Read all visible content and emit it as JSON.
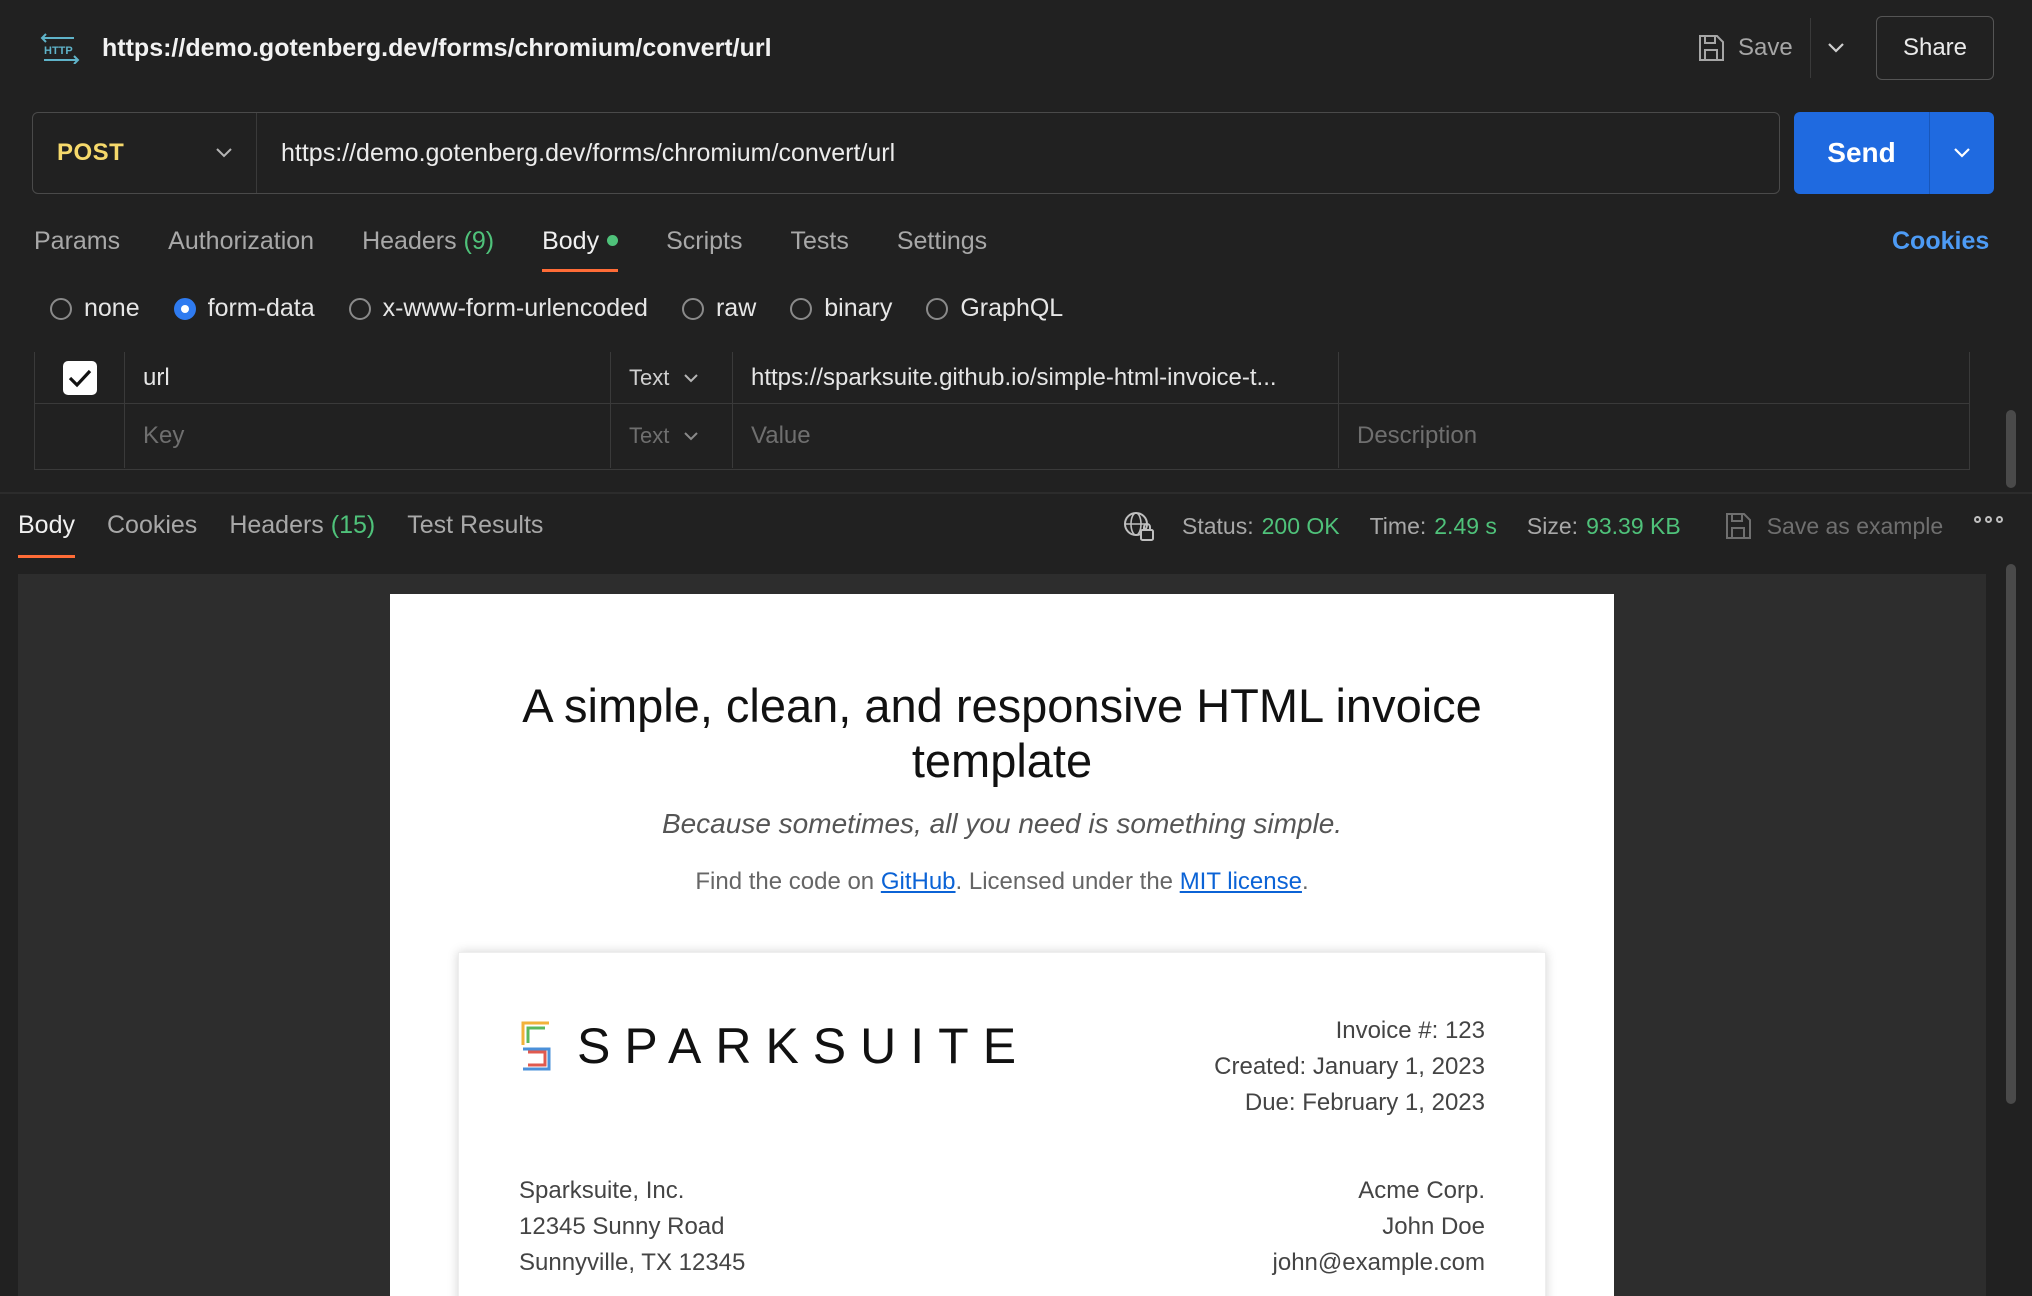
{
  "header": {
    "request_title": "https://demo.gotenberg.dev/forms/chromium/convert/url",
    "save_label": "Save",
    "share_label": "Share"
  },
  "url_bar": {
    "method": "POST",
    "url": "https://demo.gotenberg.dev/forms/chromium/convert/url",
    "send_label": "Send"
  },
  "request_tabs": {
    "params": "Params",
    "authorization": "Authorization",
    "headers": "Headers",
    "headers_count": "(9)",
    "body": "Body",
    "scripts": "Scripts",
    "tests": "Tests",
    "settings": "Settings",
    "cookies": "Cookies"
  },
  "body_types": {
    "none": "none",
    "form_data": "form-data",
    "urlencoded": "x-www-form-urlencoded",
    "raw": "raw",
    "binary": "binary",
    "graphql": "GraphQL",
    "selected": "form-data"
  },
  "form_rows": [
    {
      "checked": true,
      "key": "url",
      "type": "Text",
      "value": "https://sparksuite.github.io/simple-html-invoice-t...",
      "description": ""
    }
  ],
  "form_placeholders": {
    "key": "Key",
    "type": "Text",
    "value": "Value",
    "description": "Description"
  },
  "response_tabs": {
    "body": "Body",
    "cookies": "Cookies",
    "headers": "Headers",
    "headers_count": "(15)",
    "test_results": "Test Results"
  },
  "response_meta": {
    "status_label": "Status:",
    "status_value": "200 OK",
    "time_label": "Time:",
    "time_value": "2.49 s",
    "size_label": "Size:",
    "size_value": "93.39 KB",
    "save_example": "Save as example"
  },
  "preview": {
    "title": "A simple, clean, and responsive HTML invoice template",
    "subtitle": "Because sometimes, all you need is something simple.",
    "find_prefix": "Find the code on ",
    "github_link": "GitHub",
    "find_middle": ". Licensed under the ",
    "license_link": "MIT license",
    "find_suffix": ".",
    "logo_text": "SPARKSUITE",
    "invoice_number": "Invoice #: 123",
    "created": "Created: January 1, 2023",
    "due": "Due: February 1, 2023",
    "from": [
      "Sparksuite, Inc.",
      "12345 Sunny Road",
      "Sunnyville, TX 12345"
    ],
    "to": [
      "Acme Corp.",
      "John Doe",
      "john@example.com"
    ]
  },
  "colors": {
    "accent": "#ff6c37",
    "send": "#1f6ae0",
    "method": "#f6d96b",
    "success": "#4fc27a",
    "link": "#4d9bf5"
  },
  "icons": [
    "http-icon",
    "save-icon",
    "chevron-down-icon",
    "checkmark-icon",
    "globe-lock-icon",
    "more-icon"
  ]
}
